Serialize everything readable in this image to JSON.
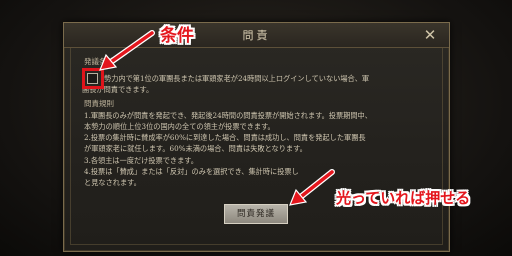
{
  "dialog": {
    "title": "問責",
    "close_glyph": "✕"
  },
  "conditions": {
    "heading": "発議条件",
    "lines": [
      "勢力内で第1位の軍團長または軍頭家老が24時間以上ログインしていない場合、軍",
      "團長が問責できます。"
    ]
  },
  "rules": {
    "heading": "問責規則",
    "lines": [
      "1.軍團長のみが問責を発起でき、発起後24時間の問責投票が開始されます。投票期間中、",
      "本勢力の順位上位3位の国内の全ての領主が投票できます。",
      "2.投票の集計時に賛成率が60%に到達した場合、問責は成功し、問責を発起した軍團長",
      "が軍頭家老に就任します。60%未満の場合、問責は失敗となります。",
      "3.各領主は一度だけ投票できます。",
      "4.投票は「賛成」または「反対」のみを選択でき、集計時に投票し",
      "と見なされます。"
    ]
  },
  "submit_button": {
    "label": "問責発議"
  },
  "annotations": {
    "condition_label": "条件",
    "button_label": "光っていれば押せる",
    "color": "#e4161d"
  }
}
